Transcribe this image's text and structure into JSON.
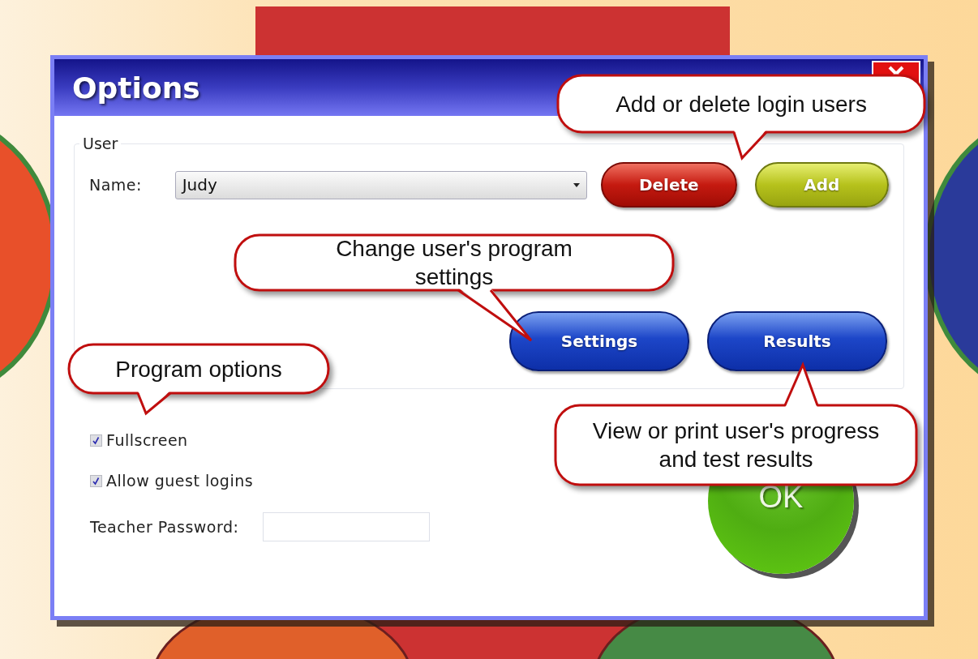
{
  "window": {
    "title": "Options"
  },
  "user_group": {
    "legend": "User",
    "name_label": "Name:",
    "name_value": "Judy",
    "delete_button": "Delete",
    "add_button": "Add",
    "settings_button": "Settings",
    "results_button": "Results"
  },
  "options": [
    {
      "label": "Fullscreen",
      "checked": true
    },
    {
      "label": "Allow guest logins",
      "checked": true
    }
  ],
  "password": {
    "label": "Teacher Password:"
  },
  "ok_button": "OK",
  "callouts": [
    {
      "text": "Add or delete login users"
    },
    {
      "text": "Change user's program settings"
    },
    {
      "text": "Program options"
    },
    {
      "text": "View or print user's progress and test results"
    }
  ]
}
